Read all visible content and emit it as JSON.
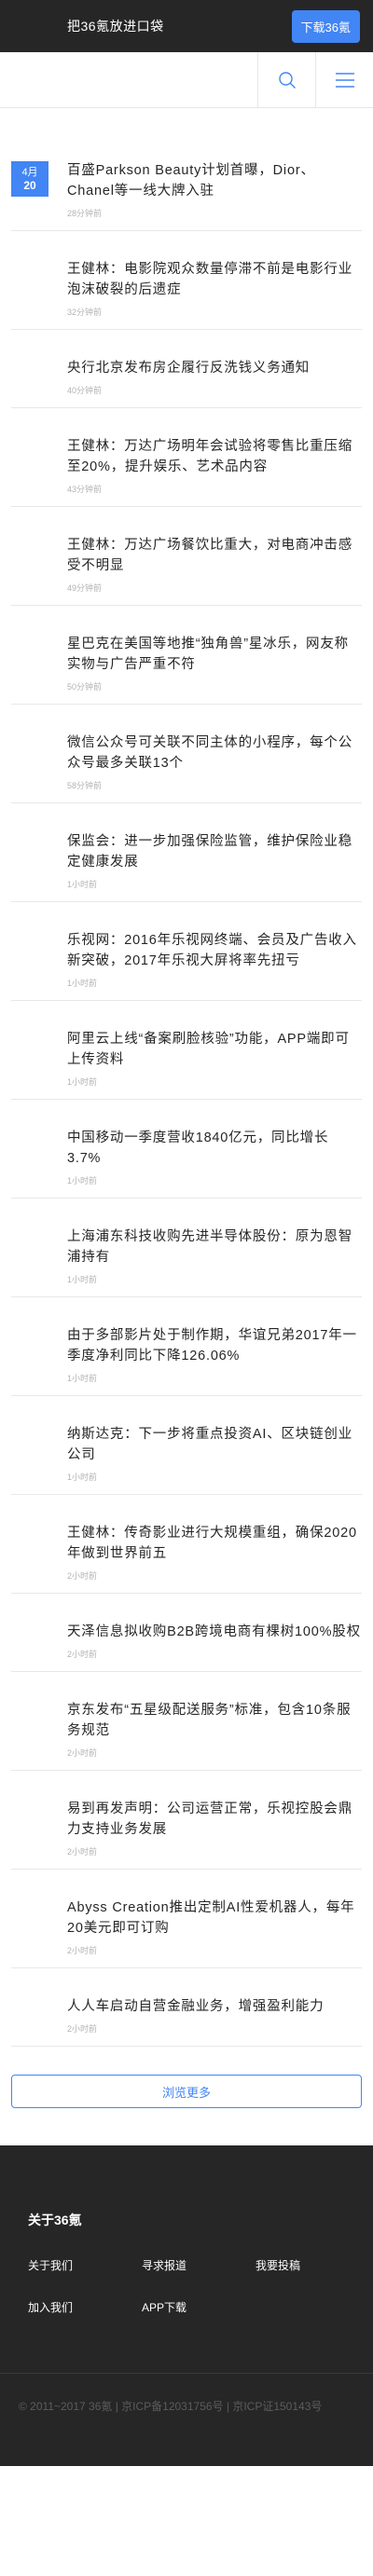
{
  "banner": {
    "title": "把36氪放进口袋",
    "download_label": "下载36氪"
  },
  "nav": {
    "search_icon": "search-icon",
    "menu_icon": "menu-icon",
    "accent": "#4285f4"
  },
  "date_badge": {
    "month": "4月",
    "day": "20"
  },
  "news": [
    {
      "title": "百盛Parkson Beauty计划首曝，Dior、Chanel等一线大牌入驻",
      "time": "28分钟前"
    },
    {
      "title": "王健林：电影院观众数量停滞不前是电影行业泡沫破裂的后遗症",
      "time": "32分钟前"
    },
    {
      "title": "央行北京发布房企履行反洗钱义务通知",
      "time": "40分钟前"
    },
    {
      "title": "王健林：万达广场明年会试验将零售比重压缩至20%，提升娱乐、艺术品内容",
      "time": "43分钟前"
    },
    {
      "title": "王健林：万达广场餐饮比重大，对电商冲击感受不明显",
      "time": "49分钟前"
    },
    {
      "title": "星巴克在美国等地推“独角兽”星冰乐，网友称实物与广告严重不符",
      "time": "50分钟前"
    },
    {
      "title": "微信公众号可关联不同主体的小程序，每个公众号最多关联13个",
      "time": "58分钟前"
    },
    {
      "title": "保监会：进一步加强保险监管，维护保险业稳定健康发展",
      "time": "1小时前"
    },
    {
      "title": "乐视网：2016年乐视网终端、会员及广告收入新突破，2017年乐视大屏将率先扭亏",
      "time": "1小时前"
    },
    {
      "title": "阿里云上线“备案刷脸核验”功能，APP端即可上传资料",
      "time": "1小时前"
    },
    {
      "title": "中国移动一季度营收1840亿元，同比增长3.7%",
      "time": "1小时前"
    },
    {
      "title": "上海浦东科技收购先进半导体股份：原为恩智浦持有",
      "time": "1小时前"
    },
    {
      "title": "由于多部影片处于制作期，华谊兄弟2017年一季度净利同比下降126.06%",
      "time": "1小时前"
    },
    {
      "title": "纳斯达克：下一步将重点投资AI、区块链创业公司",
      "time": "1小时前"
    },
    {
      "title": "王健林：传奇影业进行大规模重组，确保2020年做到世界前五",
      "time": "2小时前"
    },
    {
      "title": "天泽信息拟收购B2B跨境电商有棵树100%股权",
      "time": "2小时前"
    },
    {
      "title": "京东发布“五星级配送服务”标准，包含10条服务规范",
      "time": "2小时前"
    },
    {
      "title": "易到再发声明：公司运营正常，乐视控股会鼎力支持业务发展",
      "time": "2小时前"
    },
    {
      "title": "Abyss Creation推出定制AI性爱机器人，每年20美元即可订购",
      "time": "2小时前"
    },
    {
      "title": "人人车启动自营金融业务，增强盈利能力",
      "time": "2小时前"
    }
  ],
  "more_label": "浏览更多",
  "footer": {
    "title": "关于36氪",
    "links": [
      "关于我们",
      "寻求报道",
      "我要投稿",
      "加入我们",
      "APP下载"
    ]
  },
  "copyright": "© 2011~2017 36氪 | 京ICP备12031756号 | 京ICP证150143号"
}
